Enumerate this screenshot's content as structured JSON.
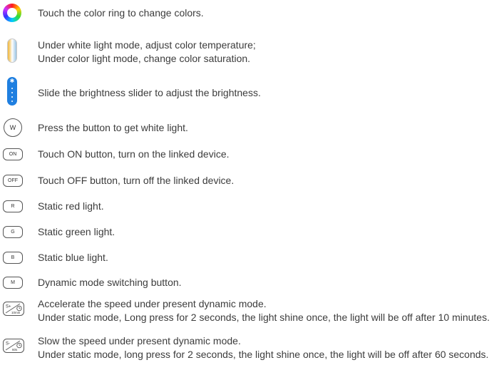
{
  "instructions": [
    {
      "id": "color-ring",
      "icon": "color-ring-icon",
      "lines": [
        "Touch the color ring to change colors."
      ]
    },
    {
      "id": "temperature",
      "icon": "color-temperature-slider-icon",
      "lines": [
        "Under white light mode, adjust color temperature;",
        "Under color light mode, change color saturation."
      ]
    },
    {
      "id": "brightness",
      "icon": "brightness-slider-icon",
      "lines": [
        "Slide the brightness slider to adjust the brightness."
      ]
    },
    {
      "id": "white",
      "icon": "white-button-icon",
      "button_label": "W",
      "lines": [
        "Press the button to get white light."
      ]
    },
    {
      "id": "on",
      "icon": "on-button-icon",
      "button_label": "ON",
      "lines": [
        "Touch ON button, turn on the linked device."
      ]
    },
    {
      "id": "off",
      "icon": "off-button-icon",
      "button_label": "OFF",
      "lines": [
        "Touch OFF button, turn off the linked device."
      ]
    },
    {
      "id": "red",
      "icon": "red-button-icon",
      "button_label": "R",
      "lines": [
        "Static red light."
      ]
    },
    {
      "id": "green",
      "icon": "green-button-icon",
      "button_label": "G",
      "lines": [
        "Static green light."
      ]
    },
    {
      "id": "blue",
      "icon": "blue-button-icon",
      "button_label": "B",
      "lines": [
        "Static blue light."
      ]
    },
    {
      "id": "mode",
      "icon": "mode-button-icon",
      "button_label": "M",
      "lines": [
        "Dynamic mode switching button."
      ]
    },
    {
      "id": "speed-up",
      "icon": "speed-up-timer-icon",
      "button_label": "S+",
      "button_sublabel": "10min",
      "lines": [
        "Accelerate the speed under present dynamic mode.",
        "Under static mode, Long press for 2 seconds, the light shine once, the light will be off after 10 minutes."
      ]
    },
    {
      "id": "speed-down",
      "icon": "speed-down-timer-icon",
      "button_label": "S-",
      "button_sublabel": "60s",
      "lines": [
        "Slow the speed under present dynamic mode.",
        "Under static mode, long press for 2 seconds, the light shine once, the light will be off after 60 seconds."
      ]
    }
  ]
}
